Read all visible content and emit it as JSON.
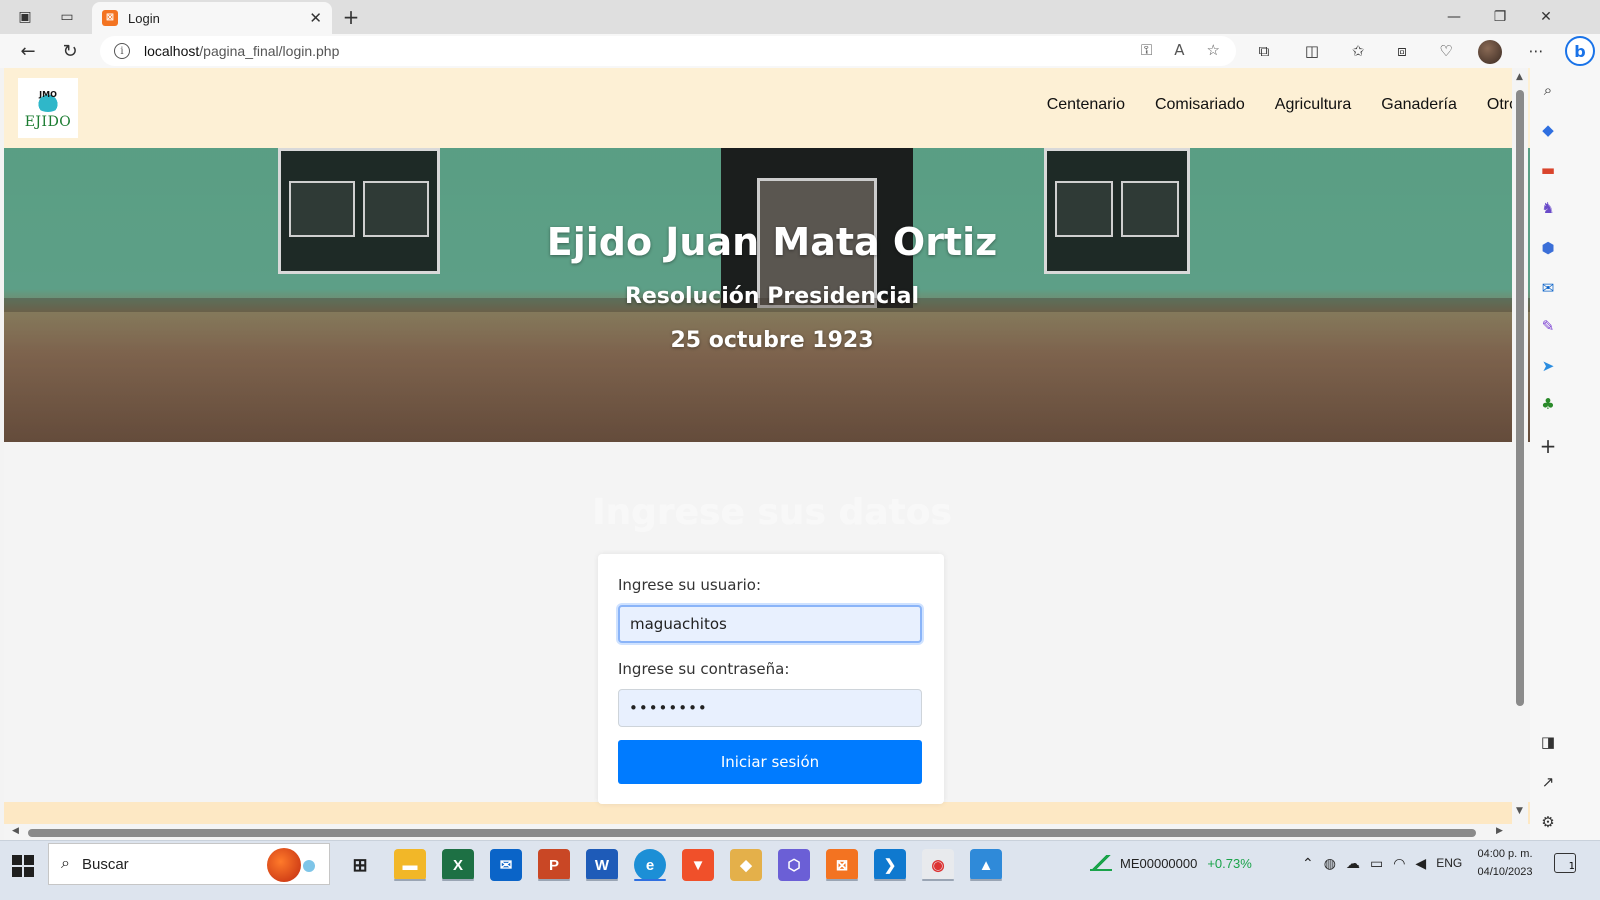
{
  "browser": {
    "tab_title": "Login",
    "tab_favicon": "xampp-icon",
    "url_host": "localhost",
    "url_path": "/pagina_final/login.php",
    "new_tab_symbol": "+",
    "close_symbol": "✕"
  },
  "site": {
    "logo_text": "EJIDO",
    "logo_mark_text": "JMO",
    "menu": [
      "Centenario",
      "Comisariado",
      "Agricultura",
      "Ganadería",
      "Otros"
    ],
    "hero_title": "Ejido Juan Mata Ortiz",
    "hero_subtitle": "Resolución Presidencial",
    "hero_date": "25 octubre 1923",
    "section_title": "Ingrese sus datos"
  },
  "login_form": {
    "user_label": "Ingrese su usuario:",
    "user_value": "maguachitos",
    "password_label": "Ingrese su contraseña:",
    "password_value": "••••••••",
    "submit_label": "Iniciar sesión"
  },
  "taskbar": {
    "search_placeholder": "Buscar",
    "stock_symbol": "ME00000000",
    "stock_change": "+0.73%",
    "language": "ENG",
    "time": "04:00 p. m.",
    "date": "04/10/2023",
    "notification_count": "1"
  },
  "colors": {
    "nav_bg": "#fdf0d5",
    "button_primary": "#007bff",
    "stock_positive": "#1aa34a"
  }
}
